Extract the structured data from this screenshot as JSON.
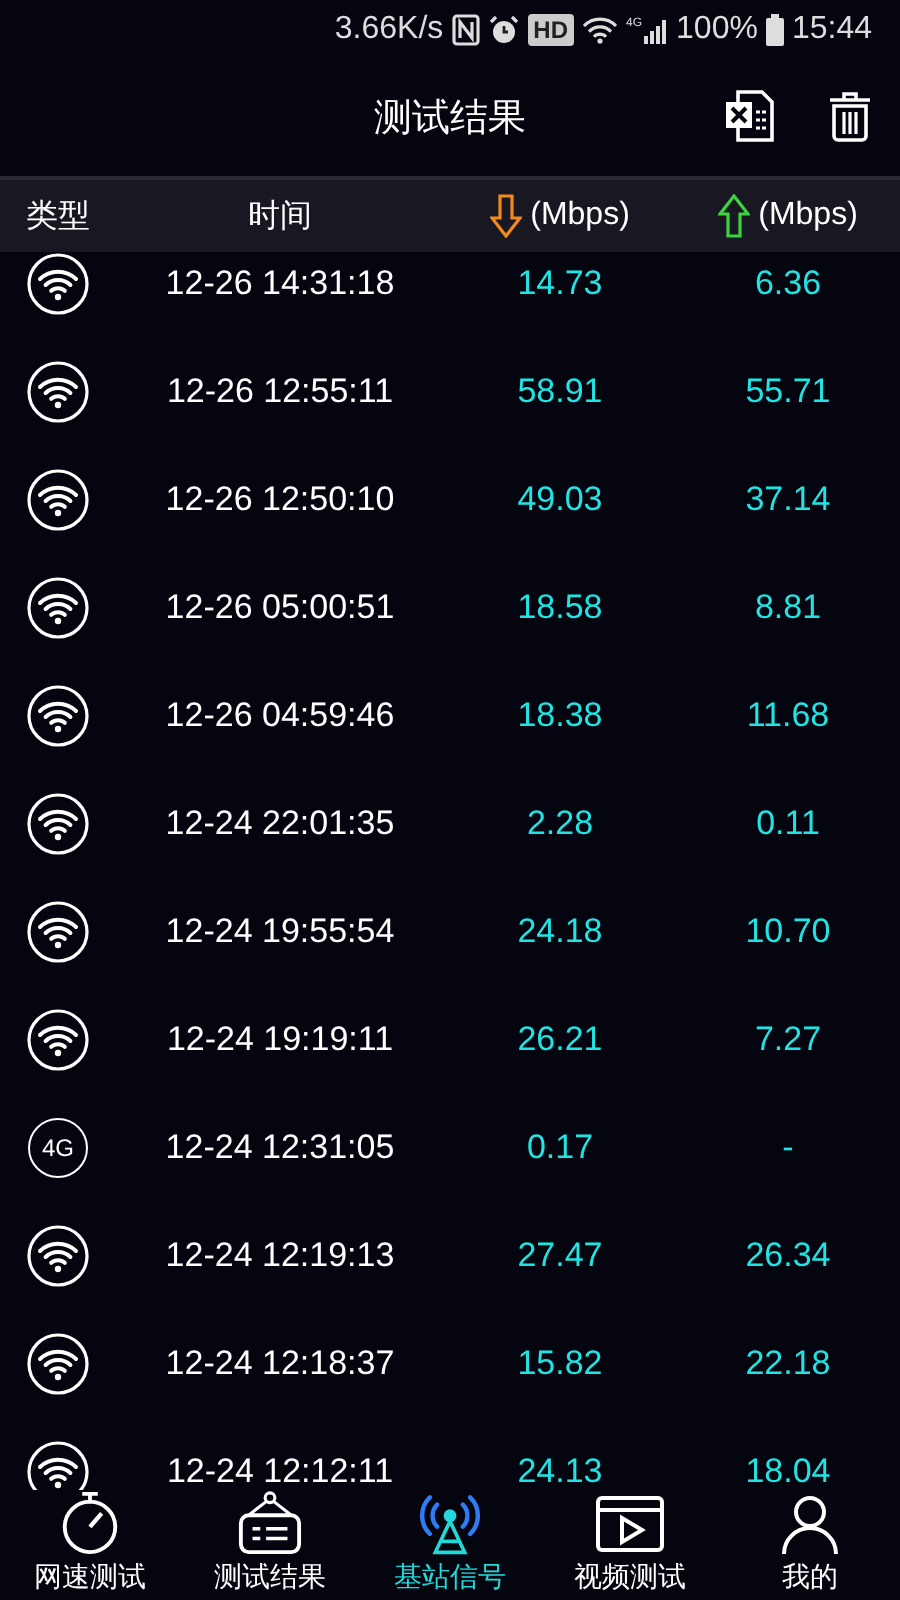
{
  "status_bar": {
    "net_speed": "3.66K/s",
    "hd_badge": "HD",
    "signal_label": "4G",
    "battery": "100%",
    "time": "15:44"
  },
  "title_bar": {
    "title": "测试结果"
  },
  "table": {
    "columns": [
      {
        "kind": "text",
        "label": "类型"
      },
      {
        "kind": "text",
        "label": "时间"
      },
      {
        "kind": "down",
        "label": "(Mbps)"
      },
      {
        "kind": "up",
        "label": "(Mbps)"
      }
    ],
    "rows": [
      {
        "kind": "wifi",
        "time": "12-26 14:31:18",
        "down": "14.73",
        "up": "6.36"
      },
      {
        "kind": "wifi",
        "time": "12-26 12:55:11",
        "down": "58.91",
        "up": "55.71"
      },
      {
        "kind": "wifi",
        "time": "12-26 12:50:10",
        "down": "49.03",
        "up": "37.14"
      },
      {
        "kind": "wifi",
        "time": "12-26 05:00:51",
        "down": "18.58",
        "up": "8.81"
      },
      {
        "kind": "wifi",
        "time": "12-26 04:59:46",
        "down": "18.38",
        "up": "11.68"
      },
      {
        "kind": "wifi",
        "time": "12-24 22:01:35",
        "down": "2.28",
        "up": "0.11"
      },
      {
        "kind": "wifi",
        "time": "12-24 19:55:54",
        "down": "24.18",
        "up": "10.70"
      },
      {
        "kind": "wifi",
        "time": "12-24 19:19:11",
        "down": "26.21",
        "up": "7.27"
      },
      {
        "kind": "cellular",
        "icon_label": "4G",
        "time": "12-24 12:31:05",
        "down": "0.17",
        "up": "-"
      },
      {
        "kind": "wifi",
        "time": "12-24 12:19:13",
        "down": "27.47",
        "up": "26.34"
      },
      {
        "kind": "wifi",
        "time": "12-24 12:18:37",
        "down": "15.82",
        "up": "22.18"
      },
      {
        "kind": "wifi",
        "time": "12-24 12:12:11",
        "down": "24.13",
        "up": "18.04"
      }
    ]
  },
  "bottom_nav": [
    {
      "kind": "stopwatch",
      "label": "网速测试",
      "selected": false
    },
    {
      "kind": "sign",
      "label": "测试结果",
      "selected": false
    },
    {
      "kind": "tower",
      "label": "基站信号",
      "selected": true
    },
    {
      "kind": "video",
      "label": "视频测试",
      "selected": false
    },
    {
      "kind": "person",
      "label": "我的",
      "selected": false
    }
  ]
}
